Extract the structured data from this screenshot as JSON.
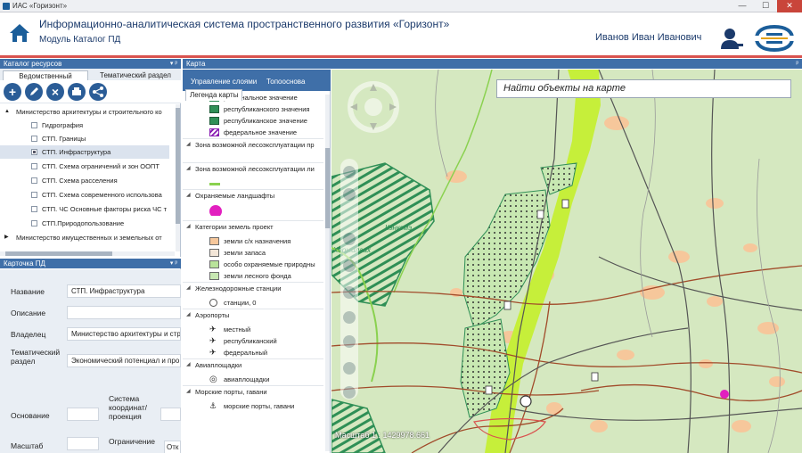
{
  "window": {
    "title": "ИАС «Горизонт»",
    "minimize": "—",
    "maximize": "☐",
    "close": "✕"
  },
  "header": {
    "app_title": "Информационно-аналитическая система пространственного развития «Горизонт»",
    "module": "Модуль Каталог ПД",
    "user_name": "Иванов Иван Иванович"
  },
  "catalog": {
    "title": "Каталог ресурсов",
    "pin": "▾ ᵖ",
    "tabs": [
      "Ведомственный",
      "Тематический раздел"
    ],
    "toolbar_icons": [
      "add-icon",
      "edit-icon",
      "delete-icon",
      "print-icon",
      "share-icon"
    ],
    "tree": [
      {
        "label": "Министерство архитектуры и строительного ко",
        "type": "group",
        "expander": "▲"
      },
      {
        "label": "Гидрография",
        "checked": false
      },
      {
        "label": "СТП. Границы",
        "checked": false
      },
      {
        "label": "СТП. Инфраструктура",
        "checked": true,
        "selected": true
      },
      {
        "label": "СТП. Схема ограничений и зон ООПТ",
        "checked": false
      },
      {
        "label": "СТП. Схема расселения",
        "checked": false
      },
      {
        "label": "СТП. Схема современного использова",
        "checked": false
      },
      {
        "label": "СТП. ЧС Основные факторы риска ЧС т",
        "checked": false
      },
      {
        "label": "СТП.Природопользование",
        "checked": false
      },
      {
        "label": "Министерство имущественных и земельных от",
        "type": "group",
        "expander": "▶"
      }
    ]
  },
  "card": {
    "title": "Карточка ПД",
    "pin": "▾ ᵖ",
    "fields": [
      {
        "label": "Название",
        "value": "СТП. Инфраструктура"
      },
      {
        "label": "Описание",
        "value": ""
      },
      {
        "label": "Владелец",
        "value": "Министерство архитектуры и стро"
      },
      {
        "label": "Тематический раздел",
        "value": "Экономический потенциал и про"
      }
    ],
    "osnovanie_label": "Основание",
    "osnovanie_value": "",
    "system_label": "Система координат/ проекция",
    "system_value": "",
    "scale_label": "Масштаб",
    "scale_value": "",
    "restriction_label": "Ограничение",
    "restriction_value": "Отк"
  },
  "map_panel": {
    "title": "Карта",
    "pin": "ᵖ",
    "tabs": [
      "Управление слоями",
      "Топооснова",
      "Легенда карты"
    ],
    "legend": [
      {
        "kind": "item",
        "label": "региональное значение",
        "swatch": "hatch-green"
      },
      {
        "kind": "item",
        "label": "республиканского значения",
        "swatch": "flag-green"
      },
      {
        "kind": "item",
        "label": "республиканское значение",
        "swatch": "flag-green"
      },
      {
        "kind": "item",
        "label": "федеральное значение",
        "swatch": "hatch-purple"
      },
      {
        "kind": "group",
        "label": "Зона возможной лесоэксплуатации пр"
      },
      {
        "kind": "blank",
        "label": ""
      },
      {
        "kind": "group",
        "label": "Зона возможной лесоэксплуатации ли"
      },
      {
        "kind": "item",
        "label": "",
        "swatch": "lime-line"
      },
      {
        "kind": "group",
        "label": "Охраняемые ландшафты"
      },
      {
        "kind": "item",
        "label": "",
        "swatch": "magenta-dot"
      },
      {
        "kind": "group",
        "label": "Категории земель проект"
      },
      {
        "kind": "item",
        "label": "земли с/х назначения",
        "swatch": "#f6c79b"
      },
      {
        "kind": "item",
        "label": "земли запаса",
        "swatch": "#f3e6d8"
      },
      {
        "kind": "item",
        "label": "особо охраняемые природны",
        "swatch": "#b9e39a"
      },
      {
        "kind": "item",
        "label": "земли лесного фонда",
        "swatch": "#c8e8b2"
      },
      {
        "kind": "group",
        "label": "Железнодорожные станции"
      },
      {
        "kind": "item",
        "label": "станции, 0",
        "swatch": "station"
      },
      {
        "kind": "group",
        "label": "Аэропорты"
      },
      {
        "kind": "item",
        "label": "местный",
        "swatch": "plane"
      },
      {
        "kind": "item",
        "label": "республиканский",
        "swatch": "plane"
      },
      {
        "kind": "item",
        "label": "федеральный",
        "swatch": "plane"
      },
      {
        "kind": "group",
        "label": "Авиаплощадки"
      },
      {
        "kind": "item",
        "label": "авиаплощадки",
        "swatch": "heli"
      },
      {
        "kind": "group",
        "label": "Морские порты, гавани"
      },
      {
        "kind": "item",
        "label": "морские порты, гавани",
        "swatch": "anchor"
      }
    ]
  },
  "map": {
    "search_placeholder": "Найти объекты на карте",
    "coords_text": "Масштаб 1 : 1429978.661",
    "label_kenkeme": "Кэнкэмэ",
    "label_kharyalaakh": "Харыйлаах",
    "colors": {
      "background": "#d5e8c0",
      "river": "#c6ef3a",
      "forest": "#2f8f56",
      "roads": "#a14b2a",
      "railway": "#555555",
      "ag_land": "#f6c79b"
    }
  }
}
